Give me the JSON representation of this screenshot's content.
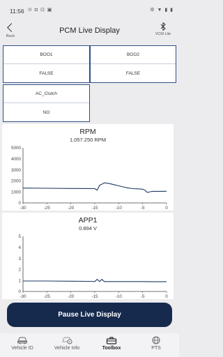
{
  "status_bar": {
    "time": "11:56",
    "left_icons": "⊙ ◘ ⊡ ▣",
    "right_icons": "⚙ ▼ ▮ ▮"
  },
  "header": {
    "back_label": "Back",
    "title": "PCM Live Display",
    "vcm_label": "VCM Lite"
  },
  "signals": [
    {
      "name": "BOO1",
      "value": "FALSE"
    },
    {
      "name": "BOO2",
      "value": "FALSE"
    },
    {
      "name": "AC_Clutch",
      "value": "NO"
    }
  ],
  "chart_data": [
    {
      "type": "line",
      "title": "RPM",
      "subtitle": "1,057.250 RPM",
      "xlim": [
        -30,
        0
      ],
      "ylim": [
        0,
        5000
      ],
      "x_ticks": [
        "-30",
        "-25",
        "-20",
        "-15",
        "-10",
        "-5",
        "0"
      ],
      "y_ticks": [
        "5000",
        "4000",
        "3000",
        "2000",
        "1000",
        "0"
      ],
      "grid": false,
      "color": "#1f3a64",
      "series": [
        {
          "x": [
            -30,
            -25,
            -20,
            -15,
            -14.5,
            -14,
            -13.5,
            -13,
            -12,
            -11,
            -10,
            -9,
            -8,
            -7,
            -6,
            -5,
            -4.5,
            -4,
            -3,
            -2,
            -1,
            0
          ],
          "y": [
            1350,
            1330,
            1310,
            1300,
            1150,
            1600,
            1700,
            1820,
            1760,
            1660,
            1550,
            1450,
            1350,
            1300,
            1280,
            1250,
            1150,
            950,
            1050,
            1050,
            1050,
            1057
          ]
        }
      ]
    },
    {
      "type": "line",
      "title": "APP1",
      "subtitle": "0.894 V",
      "xlim": [
        -30,
        0
      ],
      "ylim": [
        0,
        5
      ],
      "x_ticks": [
        "-30",
        "-25",
        "-20",
        "-15",
        "-10",
        "-5",
        "0"
      ],
      "y_ticks": [
        "5",
        "4",
        "3",
        "2",
        "1",
        "0"
      ],
      "grid": false,
      "color": "#1f3a64",
      "series": [
        {
          "x": [
            -30,
            -25,
            -20,
            -16,
            -15,
            -14.5,
            -14,
            -13.5,
            -13,
            -10,
            -5,
            -2,
            0
          ],
          "y": [
            0.95,
            0.95,
            0.93,
            0.92,
            0.9,
            1.1,
            0.9,
            1.1,
            0.9,
            0.9,
            0.9,
            0.88,
            0.894
          ]
        }
      ]
    }
  ],
  "pause_button": "Pause Live Display",
  "nav": [
    {
      "label": "Vehicle ID",
      "icon": "car-icon",
      "active": false
    },
    {
      "label": "Vehicle Info",
      "icon": "car-info-icon",
      "active": false
    },
    {
      "label": "Toolbox",
      "icon": "toolbox-icon",
      "active": true
    },
    {
      "label": "PTS",
      "icon": "globe-icon",
      "active": false
    }
  ]
}
